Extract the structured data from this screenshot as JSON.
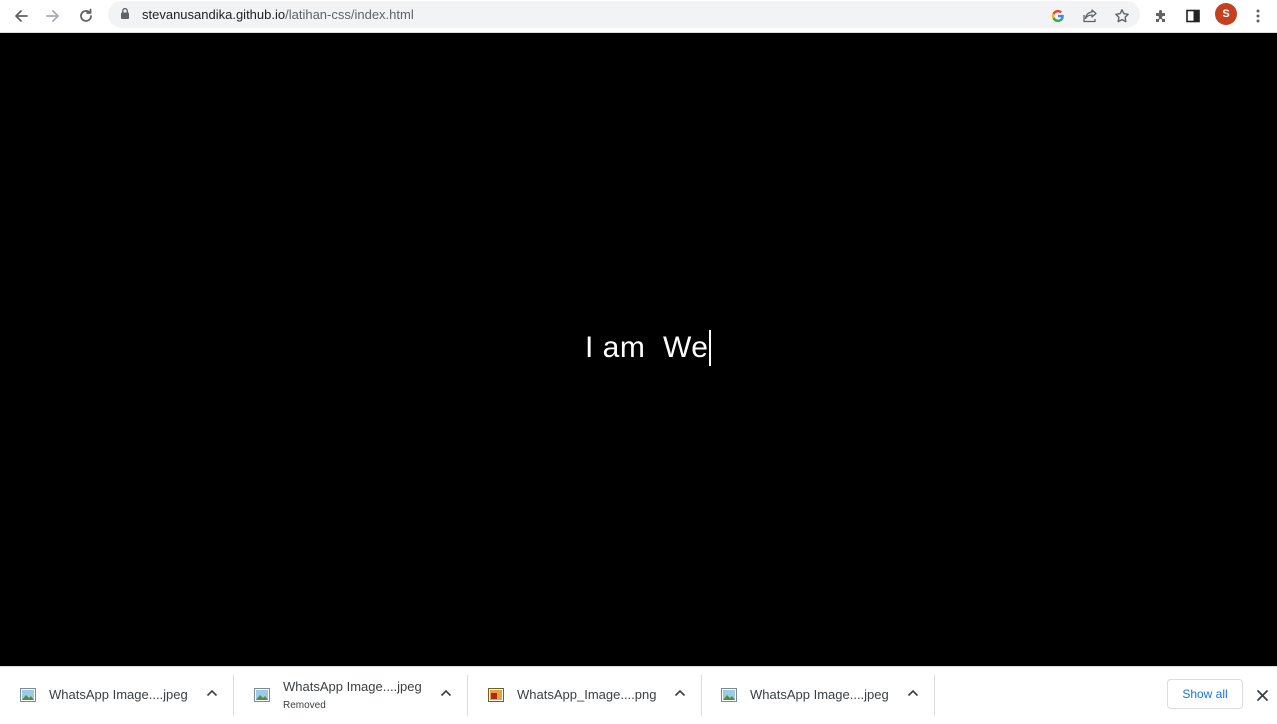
{
  "browser": {
    "url_host": "stevanusandika.github.io",
    "url_path": "/latihan-css/index.html",
    "profile_initial": "S",
    "toolbar_icons": [
      "back-icon",
      "forward-icon",
      "reload-icon",
      "lock-icon",
      "google-icon",
      "share-icon",
      "star-icon",
      "extensions-icon",
      "side-panel-icon",
      "more-icon"
    ]
  },
  "page": {
    "typed_text": "I am  We"
  },
  "downloads": {
    "items": [
      {
        "name": "WhatsApp Image....jpeg",
        "status": "",
        "icon": "image-file-icon"
      },
      {
        "name": "WhatsApp Image....jpeg",
        "status": "Removed",
        "icon": "image-file-icon"
      },
      {
        "name": "WhatsApp_Image....png",
        "status": "",
        "icon": "png-file-icon"
      },
      {
        "name": "WhatsApp Image....jpeg",
        "status": "",
        "icon": "image-file-icon"
      }
    ],
    "show_all_label": "Show all"
  },
  "colors": {
    "page_background": "#000000",
    "text": "#ffffff",
    "profile": "#c5401f",
    "link_blue": "#1a73e8"
  }
}
